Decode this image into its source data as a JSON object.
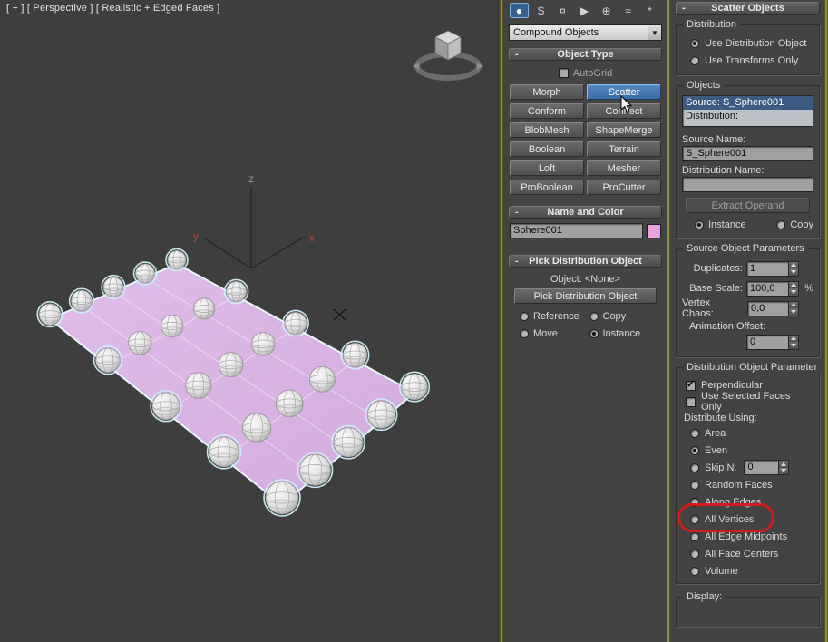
{
  "ui": {
    "collapse_glyph": "-",
    "dropdown_arrow": "▼",
    "check_glyph": "✓"
  },
  "viewport": {
    "label": "[ + ] [ Perspective ] [ Realistic + Edged Faces ]",
    "axis_x": "x",
    "axis_y": "y",
    "axis_z": "z"
  },
  "command_panel": {
    "category_icons": [
      {
        "name": "geometry",
        "glyph": "●"
      },
      {
        "name": "shapes",
        "glyph": "S"
      },
      {
        "name": "lights",
        "glyph": "¤"
      },
      {
        "name": "cameras",
        "glyph": "▶"
      },
      {
        "name": "helpers",
        "glyph": "⊕"
      },
      {
        "name": "space-warps",
        "glyph": "≈"
      },
      {
        "name": "systems",
        "glyph": "*"
      }
    ],
    "category_dropdown": "Compound Objects",
    "object_type": {
      "title": "Object Type",
      "autogrid_label": "AutoGrid",
      "buttons": [
        "Morph",
        "Scatter",
        "Conform",
        "Connect",
        "BlobMesh",
        "ShapeMerge",
        "Boolean",
        "Terrain",
        "Loft",
        "Mesher",
        "ProBoolean",
        "ProCutter"
      ],
      "active_button": "Scatter"
    },
    "name_and_color": {
      "title": "Name and Color",
      "object_name": "Sphere001",
      "color_hex": "#e9a3de"
    },
    "pick_distribution": {
      "title": "Pick Distribution Object",
      "object_label": "Object: <None>",
      "pick_button_label": "Pick Distribution Object",
      "reference_label": "Reference",
      "copy_label": "Copy",
      "move_label": "Move",
      "instance_label": "Instance",
      "selected": "Instance"
    }
  },
  "scatter_objects": {
    "title": "Scatter Objects",
    "distribution": {
      "title": "Distribution",
      "use_distribution_object": "Use Distribution Object",
      "use_transforms_only": "Use Transforms Only",
      "selected": "Use Distribution Object"
    },
    "objects": {
      "title": "Objects",
      "list_items": [
        "Source: S_Sphere001",
        "Distribution:"
      ],
      "source_name_label": "Source Name:",
      "source_name_value": "S_Sphere001",
      "distribution_name_label": "Distribution Name:",
      "distribution_name_value": "",
      "extract_operand_label": "Extract Operand",
      "instance_label": "Instance",
      "copy_label": "Copy",
      "selected": "Instance"
    },
    "source_object_parameters": {
      "title": "Source Object Parameters",
      "duplicates_label": "Duplicates:",
      "duplicates_value": "1",
      "base_scale_label": "Base Scale:",
      "base_scale_value": "100,0",
      "base_scale_unit": "%",
      "vertex_chaos_label": "Vertex Chaos:",
      "vertex_chaos_value": "0,0",
      "animation_offset_label": "Animation Offset:",
      "animation_offset_value": "0"
    },
    "distribution_object_parameter": {
      "title": "Distribution Object Parameter",
      "perpendicular_label": "Perpendicular",
      "use_selected_faces_label": "Use Selected Faces Only",
      "distribute_using_label": "Distribute Using:",
      "options": [
        "Area",
        "Even",
        "Skip N:",
        "Random Faces",
        "Along Edges",
        "All Vertices",
        "All Edge Midpoints",
        "All Face Centers",
        "Volume"
      ],
      "selected_option": "Even",
      "skip_n_value": "0",
      "highlighted_option": "All Vertices",
      "highlight_color": "#d01c1c"
    },
    "display": {
      "title": "Display:"
    }
  }
}
